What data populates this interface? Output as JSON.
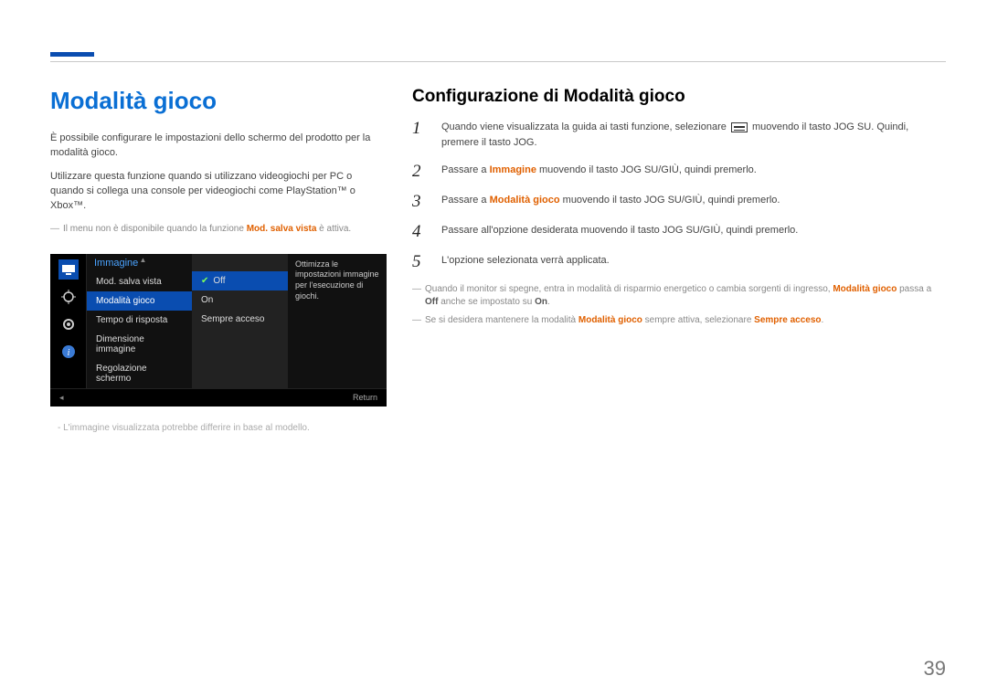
{
  "page_number": "39",
  "left": {
    "heading": "Modalità gioco",
    "para1": "È possibile configurare le impostazioni dello schermo del prodotto per la modalità gioco.",
    "para2": "Utilizzare questa funzione quando si utilizzano videogiochi per PC o quando si collega una console per videogiochi come PlayStation™ o Xbox™.",
    "note1_a": "Il menu non è disponibile quando la funzione ",
    "note1_b": "Mod. salva vista",
    "note1_c": " è attiva.",
    "image_note": "L'immagine visualizzata potrebbe differire in base al modello."
  },
  "osd": {
    "category_title": "Immagine",
    "items": [
      "Mod. salva vista",
      "Modalità gioco",
      "Tempo di risposta",
      "Dimensione immagine",
      "Regolazione schermo"
    ],
    "selected_index": 1,
    "options": [
      "Off",
      "On",
      "Sempre acceso"
    ],
    "selected_option_index": 0,
    "description": "Ottimizza le impostazioni immagine per l'esecuzione di giochi.",
    "return_label": "Return"
  },
  "right": {
    "heading": "Configurazione di Modalità gioco",
    "steps": [
      {
        "num": "1",
        "parts": [
          {
            "t": "Quando viene visualizzata la guida ai tasti funzione, selezionare "
          },
          {
            "icon": "menu"
          },
          {
            "t": " muovendo il tasto JOG SU. Quindi, premere il tasto JOG."
          }
        ]
      },
      {
        "num": "2",
        "parts": [
          {
            "t": "Passare a "
          },
          {
            "em": "Immagine"
          },
          {
            "t": " muovendo il tasto JOG SU/GIÙ, quindi premerlo."
          }
        ]
      },
      {
        "num": "3",
        "parts": [
          {
            "t": "Passare a "
          },
          {
            "em": "Modalità gioco"
          },
          {
            "t": " muovendo il tasto JOG SU/GIÙ, quindi premerlo."
          }
        ]
      },
      {
        "num": "4",
        "parts": [
          {
            "t": "Passare all'opzione desiderata muovendo il tasto JOG SU/GIÙ, quindi premerlo."
          }
        ]
      },
      {
        "num": "5",
        "parts": [
          {
            "t": "L'opzione selezionata verrà applicata."
          }
        ]
      }
    ],
    "note2": [
      {
        "t": "Quando il monitor si spegne, entra in modalità di risparmio energetico o cambia sorgenti di ingresso, "
      },
      {
        "em": "Modalità gioco"
      },
      {
        "t": " passa a "
      },
      {
        "bold": "Off"
      },
      {
        "t": " anche se impostato su "
      },
      {
        "bold": "On"
      },
      {
        "t": "."
      }
    ],
    "note3": [
      {
        "t": "Se si desidera mantenere la modalità "
      },
      {
        "em": "Modalità gioco"
      },
      {
        "t": " sempre attiva, selezionare "
      },
      {
        "em": "Sempre acceso"
      },
      {
        "t": "."
      }
    ]
  }
}
